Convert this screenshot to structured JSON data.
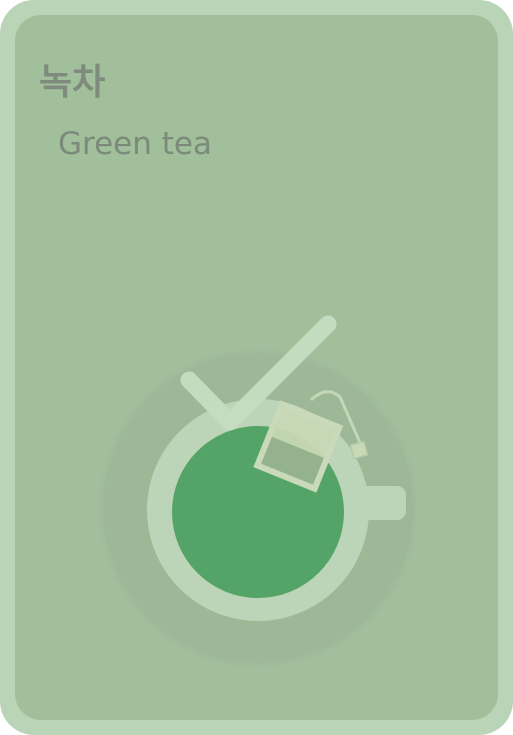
{
  "card": {
    "title": "녹차",
    "subtitle": "Green tea",
    "selected": true
  },
  "icons": {
    "illustration": "green-tea-cup-icon",
    "status": "checkmark-icon"
  },
  "colors": {
    "card_border": "#b9d4b7",
    "card_background": "#a0bf9a",
    "tea": "#55a467",
    "cup": "#bcd4b7",
    "halo": "#9cb697",
    "check": "#c5dcc0"
  }
}
